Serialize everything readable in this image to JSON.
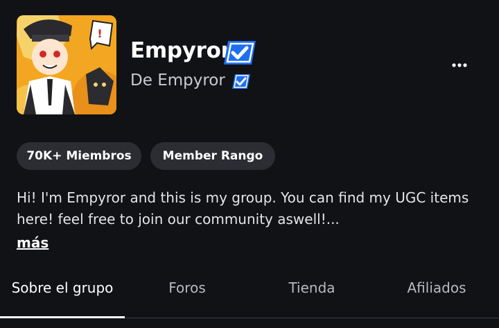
{
  "group": {
    "name": "Empyror",
    "owner_prefix": "De",
    "owner_name": "Empyror",
    "verified_icon": "verified-badge-icon",
    "accent_color": "#1d6ff2"
  },
  "stats": {
    "members_label": "70K+ Miembros",
    "rank_label": "Member Rango"
  },
  "description": {
    "text": "Hi! I'm Empyror and this is my group. You can find my UGC items here! feel free to join our community aswell!...",
    "more_label": "más"
  },
  "tabs": [
    {
      "label": "Sobre el grupo",
      "active": true
    },
    {
      "label": "Foros",
      "active": false
    },
    {
      "label": "Tienda",
      "active": false
    },
    {
      "label": "Afiliados",
      "active": false
    }
  ],
  "menu_icon": "more-options-icon"
}
